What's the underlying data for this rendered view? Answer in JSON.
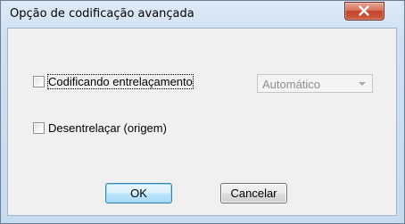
{
  "window": {
    "title": "Opção de codificação avançada",
    "close_icon": "close-x-icon"
  },
  "options": {
    "interlace_encoding": {
      "label": "Codificando entrelaçamento",
      "checked": false
    },
    "interlace_mode": {
      "value": "Automático",
      "enabled": false
    },
    "deinterlace": {
      "label": "Desentrelaçar (origem)",
      "checked": false
    }
  },
  "buttons": {
    "ok_label": "OK",
    "cancel_label": "Cancelar"
  },
  "colors": {
    "close_button": "#c4442c",
    "default_button_border": "#3c7fb1"
  }
}
